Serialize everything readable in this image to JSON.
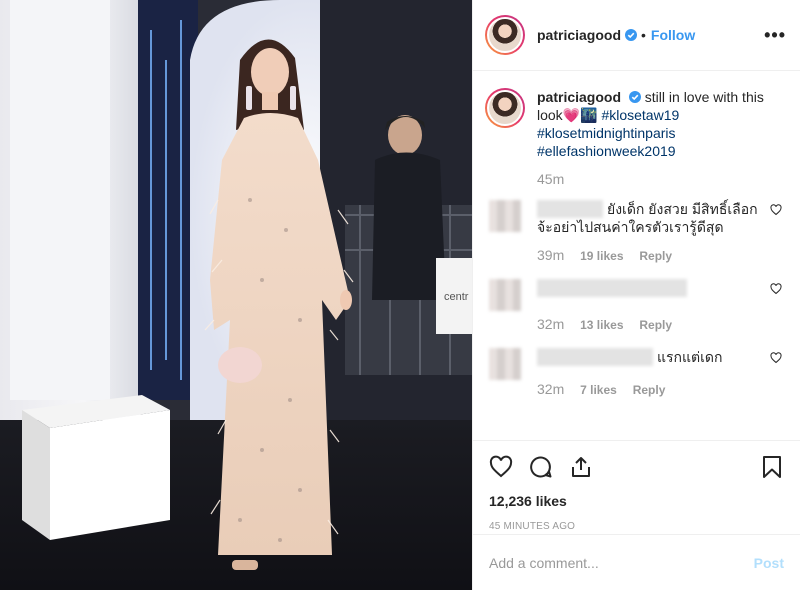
{
  "post": {
    "username": "patriciagood",
    "follow_label": "Follow",
    "more_label": "•••",
    "caption_text": "still in love with this look💗🌃",
    "hashtags": [
      "#klosetaw19",
      "#klosetmidnightinparis",
      "#ellefashionweek2019"
    ],
    "caption_time": "45m",
    "likes": "12,236 likes",
    "posted_ago": "45 MINUTES AGO",
    "photo_sign": "centr"
  },
  "comments": [
    {
      "text": "ยังเด็ก ยังสวย มีสิทธิ์เลือก จ้ะอย่าไปสนค่าใครตัวเรารู้ดีสุด",
      "time": "39m",
      "likes": "19 likes",
      "reply": "Reply"
    },
    {
      "text": "",
      "time": "32m",
      "likes": "13 likes",
      "reply": "Reply"
    },
    {
      "text": "แรกแต่เดก",
      "time": "32m",
      "likes": "7 likes",
      "reply": "Reply"
    }
  ],
  "composer": {
    "placeholder": "Add a comment...",
    "post_label": "Post"
  },
  "icons": {
    "verified": "verified-badge-icon",
    "like": "heart-icon",
    "comment": "comment-icon",
    "share": "share-icon",
    "save": "bookmark-icon"
  },
  "colors": {
    "link": "#3897f0",
    "hashtag": "#003569",
    "muted": "#999999",
    "post_disabled": "#b2dffc"
  }
}
